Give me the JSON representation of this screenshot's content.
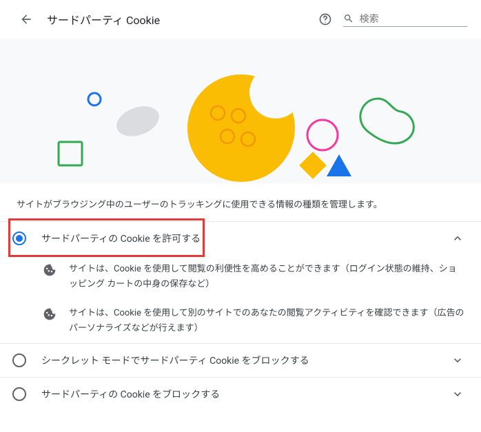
{
  "header": {
    "title": "サードパーティ Cookie",
    "search_placeholder": "検索"
  },
  "description": "サイトがブラウジング中のユーザーのトラッキングに使用できる情報の種類を管理します。",
  "options": [
    {
      "label": "サードパーティの Cookie を許可する",
      "selected": true,
      "expanded": true
    },
    {
      "label": "シークレット モードでサードパーティ Cookie をブロックする",
      "selected": false,
      "expanded": false
    },
    {
      "label": "サードパーティの Cookie をブロックする",
      "selected": false,
      "expanded": false
    }
  ],
  "details": [
    "サイトは、Cookie を使用して閲覧の利便性を高めることができます（ログイン状態の維持、ショッピング カートの中身の保存など）",
    "サイトは、Cookie を使用して別のサイトでのあなたの閲覧アクティビティを確認できます（広告のパーソナライズなどが行えます）"
  ]
}
